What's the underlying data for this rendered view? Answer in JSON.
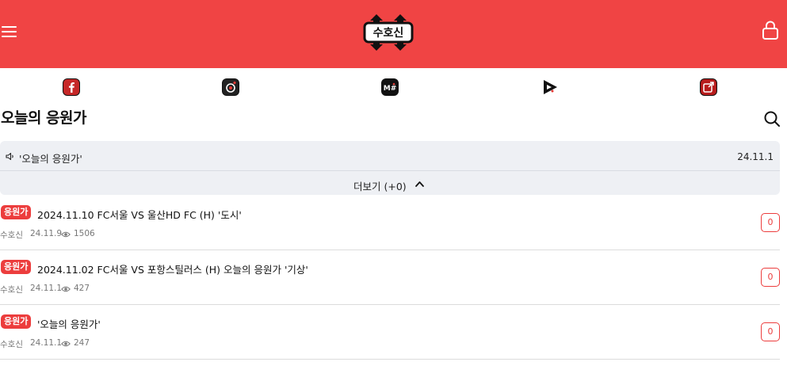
{
  "header": {
    "logo_text": "수호신",
    "brand_color": "#f04444",
    "menu_icon": "hamburger-menu-icon",
    "login_icon": "lock-icon"
  },
  "social_links": [
    {
      "icon": "facebook-icon"
    },
    {
      "icon": "instagram-icon"
    },
    {
      "icon": "media-icon"
    },
    {
      "icon": "youtube-icon"
    },
    {
      "icon": "external-link-icon"
    }
  ],
  "board": {
    "title": "오늘의 응원가",
    "search_icon": "search-icon"
  },
  "notice": {
    "title": "'오늘의 응원가'",
    "date": "24.11.1",
    "more_label": "더보기 (+0)"
  },
  "posts": [
    {
      "tag": "응원가",
      "title": "2024.11.10 FC서울 VS 울산HD FC (H) '도시'",
      "author": "수호신",
      "date": "24.11.9",
      "views": "1506",
      "comments": "0"
    },
    {
      "tag": "응원가",
      "title": "2024.11.02 FC서울 VS 포항스틸러스 (H) 오늘의 응원가 '기상'",
      "author": "수호신",
      "date": "24.11.1",
      "views": "427",
      "comments": "0"
    },
    {
      "tag": "응원가",
      "title": "'오늘의 응원가'",
      "author": "수호신",
      "date": "24.11.1",
      "views": "247",
      "comments": "0"
    }
  ]
}
